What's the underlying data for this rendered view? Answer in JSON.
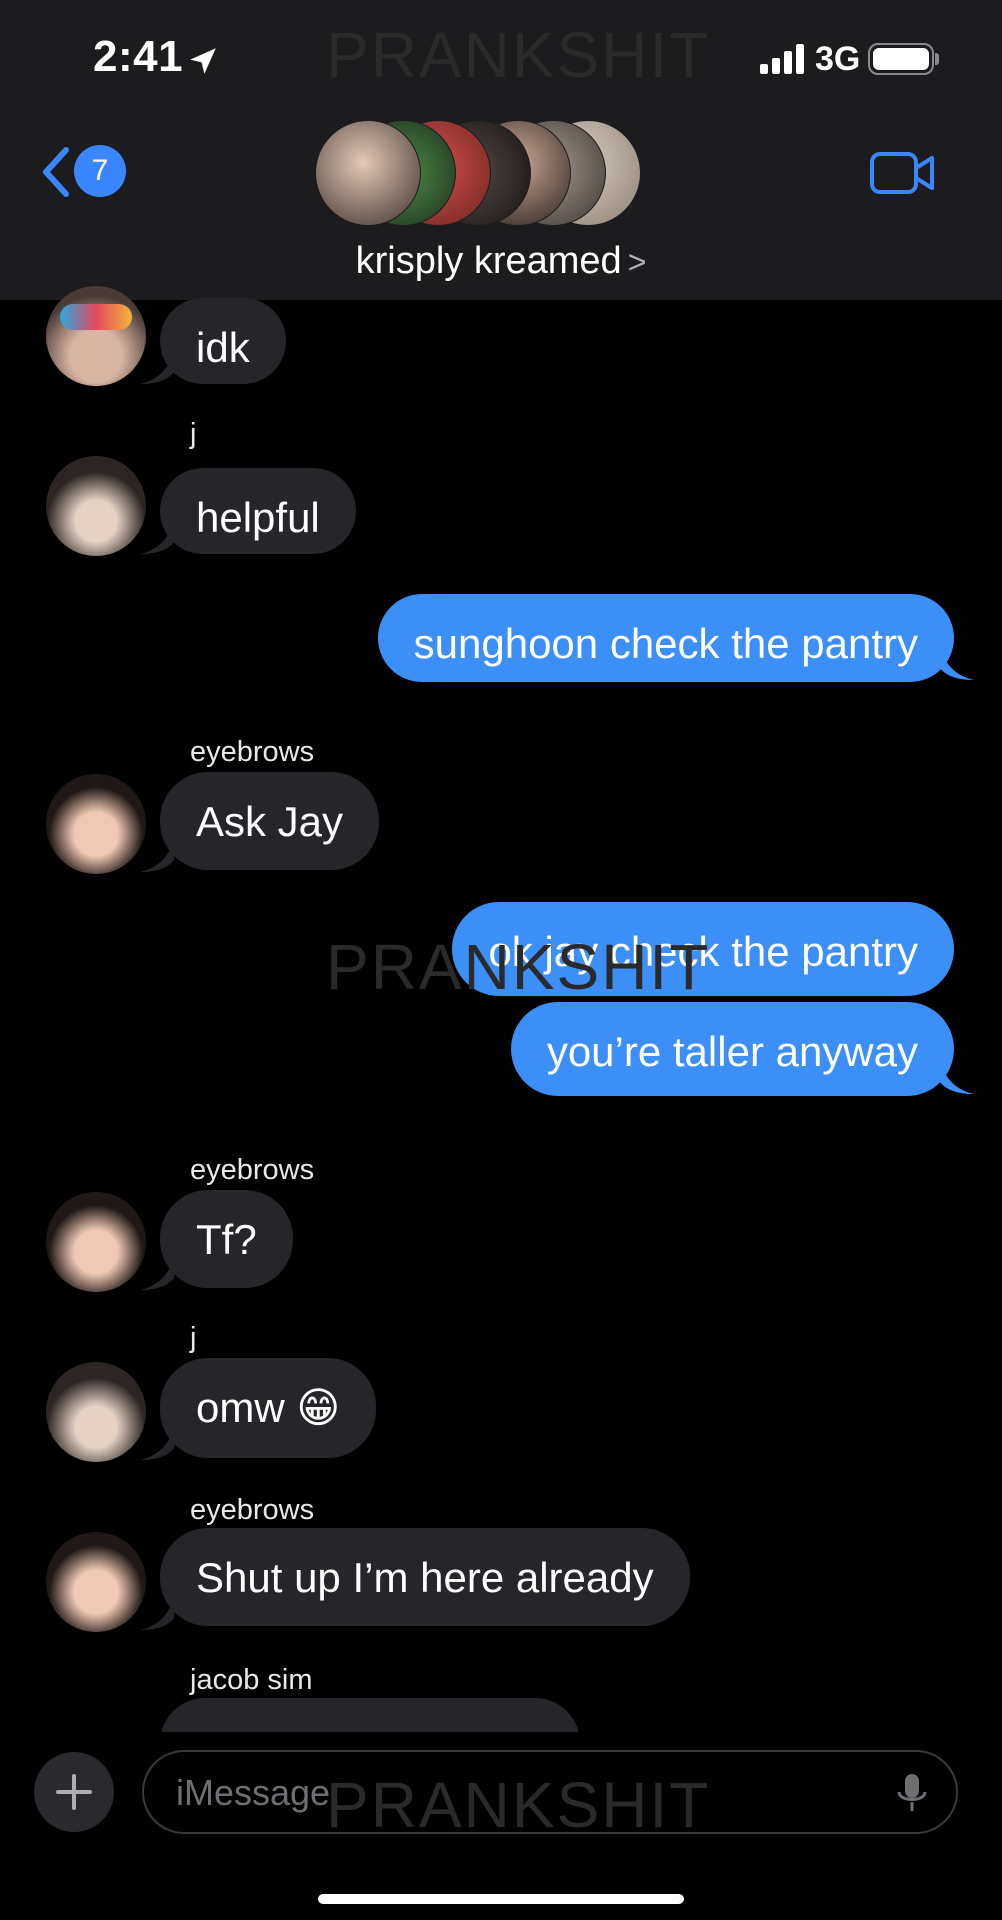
{
  "status_bar": {
    "time": "2:41",
    "network": "3G"
  },
  "watermark": "PRANKSHIT",
  "header": {
    "back_count": "7",
    "group_name": "krisply kreamed",
    "chevron": ">"
  },
  "messages": [
    {
      "dir": "in",
      "sender": "",
      "text": "idk"
    },
    {
      "dir": "in",
      "sender": "j",
      "text": "helpful"
    },
    {
      "dir": "out",
      "sender": "",
      "text": "sunghoon check the pantry"
    },
    {
      "dir": "in",
      "sender": "eyebrows",
      "text": "Ask Jay"
    },
    {
      "dir": "out",
      "sender": "",
      "text": "ok jay check the pantry"
    },
    {
      "dir": "out",
      "sender": "",
      "text": "you’re taller anyway"
    },
    {
      "dir": "in",
      "sender": "eyebrows",
      "text": "Tf?"
    },
    {
      "dir": "in",
      "sender": "j",
      "text": "omw 😁"
    },
    {
      "dir": "in",
      "sender": "eyebrows",
      "text": "Shut up I’m here already"
    },
    {
      "dir": "in",
      "sender": "jacob sim",
      "text": ""
    }
  ],
  "composer": {
    "placeholder": "iMessage"
  },
  "colors": {
    "outgoing": "#3b8ff7",
    "incoming": "#26262a",
    "accent": "#3a86ff"
  },
  "icons": [
    "location-arrow-icon",
    "signal-icon",
    "battery-icon",
    "back-chevron-icon",
    "video-camera-icon",
    "plus-icon",
    "microphone-icon"
  ]
}
